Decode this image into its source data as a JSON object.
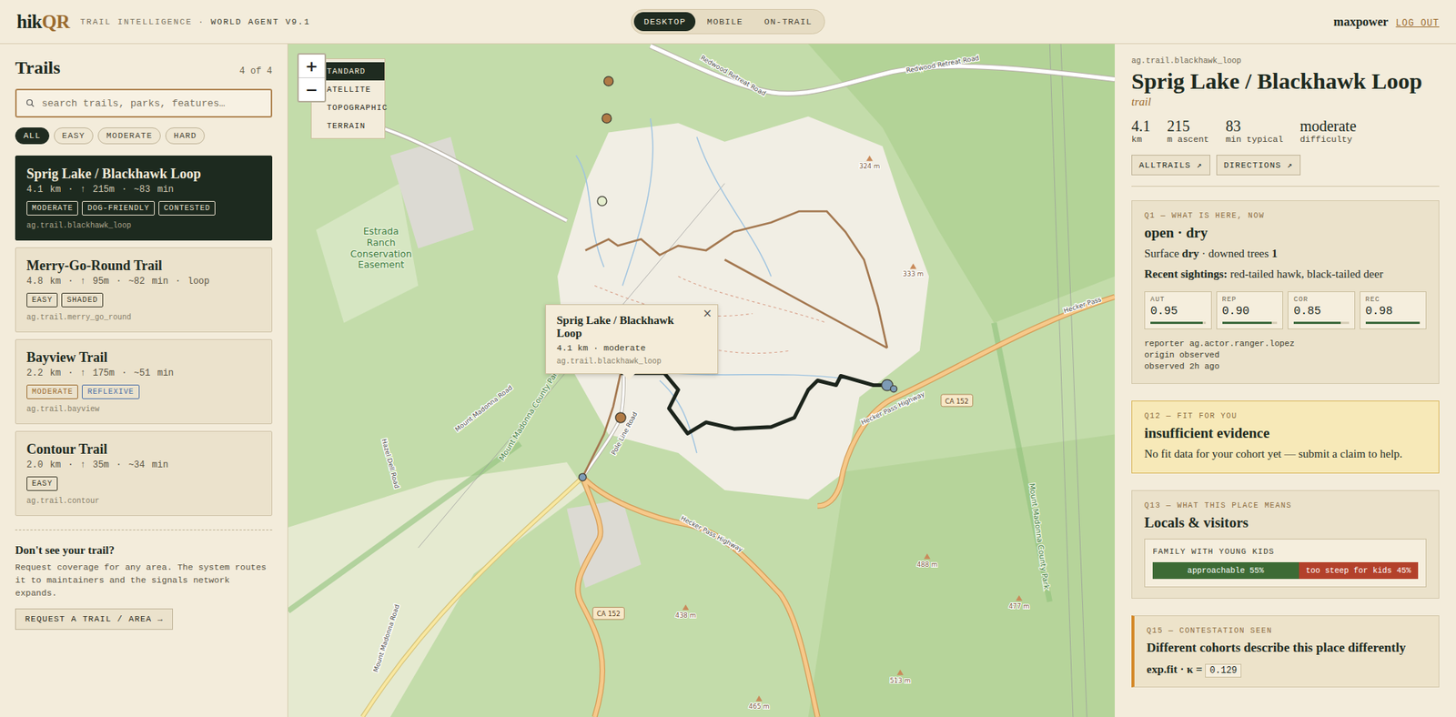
{
  "header": {
    "logo": {
      "main": "hik",
      "accent": "QR"
    },
    "tagline": "TRAIL INTELLIGENCE ·",
    "version": "WORLD AGENT V9.1",
    "modes": [
      {
        "label": "DESKTOP",
        "selected": true
      },
      {
        "label": "MOBILE",
        "selected": false
      },
      {
        "label": "ON-TRAIL",
        "selected": false
      }
    ],
    "user": "maxpower",
    "logout": "LOG OUT"
  },
  "sidebar": {
    "title": "Trails",
    "count": "4 of 4",
    "search": {
      "placeholder": "search trails, parks, features…"
    },
    "filters": [
      {
        "label": "ALL",
        "selected": true
      },
      {
        "label": "EASY",
        "selected": false
      },
      {
        "label": "MODERATE",
        "selected": false
      },
      {
        "label": "HARD",
        "selected": false
      }
    ],
    "trails": [
      {
        "name": "Sprig Lake / Blackhawk Loop",
        "stats": "4.1 km · ↑ 215m · ~83 min",
        "tags": [
          {
            "label": "MODERATE",
            "color": "#e8e0cc"
          },
          {
            "label": "DOG-FRIENDLY",
            "color": "#e8e0cc"
          },
          {
            "label": "CONTESTED",
            "color": "#e8e0cc"
          }
        ],
        "id": "ag.trail.blackhawk_loop",
        "selected": true
      },
      {
        "name": "Merry-Go-Round Trail",
        "stats": "4.8 km · ↑ 95m · ~82 min · loop",
        "tags": [
          {
            "label": "EASY",
            "color": "#3a3828"
          },
          {
            "label": "SHADED",
            "color": "#3a3828"
          }
        ],
        "id": "ag.trail.merry_go_round",
        "selected": false
      },
      {
        "name": "Bayview Trail",
        "stats": "2.2 km · ↑ 175m · ~51 min",
        "tags": [
          {
            "label": "MODERATE",
            "color": "#9a6a2e"
          },
          {
            "label": "REFLEXIVE",
            "color": "#4a6ea6"
          }
        ],
        "id": "ag.trail.bayview",
        "selected": false
      },
      {
        "name": "Contour Trail",
        "stats": "2.0 km · ↑ 35m · ~34 min",
        "tags": [
          {
            "label": "EASY",
            "color": "#3a3828"
          }
        ],
        "id": "ag.trail.contour",
        "selected": false
      }
    ],
    "request": {
      "title": "Don't see your trail?",
      "text": "Request coverage for any area. The system routes it to maintainers and the signals network expands.",
      "button": "REQUEST A TRAIL / AREA →"
    }
  },
  "map": {
    "zoom_in": "+",
    "zoom_out": "−",
    "layers": [
      {
        "label": "TANDARD",
        "selected": true
      },
      {
        "label": "ATELLITE",
        "selected": false
      },
      {
        "label": "TOPOGRAPHIC",
        "selected": false
      },
      {
        "label": "TERRAIN",
        "selected": false
      }
    ],
    "popup": {
      "title": "Sprig Lake / Blackhawk Loop",
      "meta": "4.1 km · moderate",
      "id": "ag.trail.blackhawk_loop",
      "close": "×"
    },
    "labels": [
      {
        "kind": "road",
        "text": "Redwood Retreat Road"
      },
      {
        "kind": "road",
        "text": "Redwood Retreat Road"
      },
      {
        "kind": "area",
        "text": "Mount Madonna County Park"
      },
      {
        "kind": "road",
        "text": "Mount Madonna Road"
      },
      {
        "kind": "road",
        "text": "Hazel Dell Road"
      },
      {
        "kind": "road",
        "text": "Pole Line Road"
      },
      {
        "kind": "road",
        "text": "Hecker Pass Highway"
      },
      {
        "kind": "shield",
        "text": "CA 152"
      },
      {
        "kind": "road",
        "text": "Hecker Pass Highway"
      },
      {
        "kind": "shield",
        "text": "CA 152"
      },
      {
        "kind": "road",
        "text": "Hecker Pass"
      },
      {
        "kind": "area",
        "text": "Mount Madonna County Park"
      },
      {
        "kind": "road",
        "text": "Mount Madonna Road"
      },
      {
        "kind": "peak",
        "text": "324 m"
      },
      {
        "kind": "peak",
        "text": "333 m"
      },
      {
        "kind": "peak",
        "text": "488 m"
      },
      {
        "kind": "peak",
        "text": "477 m"
      },
      {
        "kind": "peak",
        "text": "513 m"
      },
      {
        "kind": "peak",
        "text": "438 m"
      },
      {
        "kind": "peak",
        "text": "465 m"
      },
      {
        "kind": "area-block",
        "text": "Estrada Ranch Conservation Easement",
        "lines": [
          "Estrada",
          "Ranch",
          "Conservation",
          "Easement"
        ]
      }
    ],
    "pins": [
      {
        "color": "#b07a45"
      },
      {
        "color": "#b07a45"
      },
      {
        "color": "#e6efcf"
      },
      {
        "color": "#b07a45"
      },
      {
        "color": "#7d9bb5"
      },
      {
        "color": "#7d9bb5"
      },
      {
        "color": "#7d9bb5"
      }
    ]
  },
  "detail": {
    "id": "ag.trail.blackhawk_loop",
    "title": "Sprig Lake / Blackhawk Loop",
    "kind": "trail",
    "stats": [
      {
        "value": "4.1",
        "label": "km"
      },
      {
        "value": "215",
        "label": "m ascent"
      },
      {
        "value": "83",
        "label": "min typical"
      },
      {
        "value": "moderate",
        "label": "difficulty"
      }
    ],
    "links": [
      "ALLTRAILS ↗",
      "DIRECTIONS ↗"
    ],
    "q1": {
      "eyebrow": "Q1 — WHAT IS HERE, NOW",
      "headline": "open · dry",
      "surface": [
        {
          "text": "Surface ",
          "bold": false
        },
        {
          "text": "dry",
          "bold": true
        },
        {
          "text": " · downed trees ",
          "bold": false
        },
        {
          "text": "1",
          "bold": true
        }
      ],
      "sightings": {
        "label": "Recent sightings:",
        "value": "red-tailed hawk, black-tailed deer"
      },
      "metrics": [
        {
          "label": "AUT",
          "value": "0.95",
          "level": 0.95
        },
        {
          "label": "REP",
          "value": "0.90",
          "level": 0.9
        },
        {
          "label": "COR",
          "value": "0.85",
          "level": 0.85
        },
        {
          "label": "REC",
          "value": "0.98",
          "level": 0.98
        }
      ],
      "provenance": [
        {
          "key": "reporter",
          "value": "ag.actor.ranger.lopez"
        },
        {
          "key": "origin",
          "value": "observed"
        },
        {
          "key": "observed",
          "value": "2h ago"
        }
      ]
    },
    "q12": {
      "eyebrow": "Q12 — FIT FOR YOU",
      "headline": "insufficient evidence",
      "text": "No fit data for your cohort yet — submit a claim to help."
    },
    "q13": {
      "eyebrow": "Q13 — WHAT THIS PLACE MEANS",
      "headline": "Locals & visitors",
      "cohort": {
        "label": "FAMILY WITH YOUNG KIDS",
        "segments": [
          {
            "label": "approachable 55%",
            "level": 0.55,
            "color": "#3d6b35"
          },
          {
            "label": "too steep for kids 45%",
            "level": 0.45,
            "color": "#b3412b"
          }
        ]
      }
    },
    "q15": {
      "eyebrow": "Q15 — CONTESTATION SEEN",
      "headline": "Different cohorts describe this place differently",
      "stat_label": "exp.fit · κ =",
      "stat_value": "0.129"
    }
  }
}
